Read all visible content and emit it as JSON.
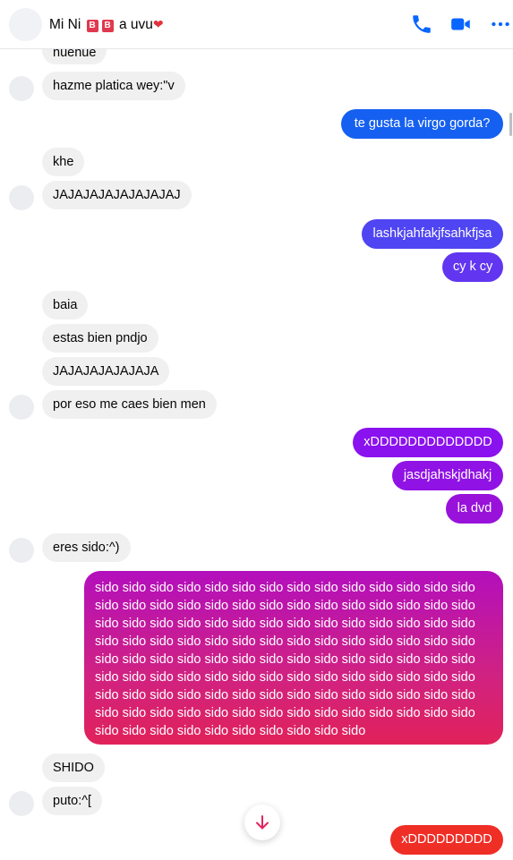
{
  "header": {
    "name_part1": "Mi Ni",
    "badge1": "B",
    "badge2": "B",
    "name_part2": "a uvu",
    "heart": "❤",
    "icons": [
      "phone-icon",
      "video-icon",
      "more-icon"
    ],
    "accent_color": "#0866ff"
  },
  "messages": [
    {
      "dir": "in",
      "text": "huehue"
    },
    {
      "dir": "in",
      "text": "hazme platica wey:\"v"
    },
    {
      "dir": "out",
      "text": "te gusta la virgo gorda?"
    },
    {
      "dir": "in",
      "text": "khe"
    },
    {
      "dir": "in",
      "text": "JAJAJAJAJAJAJAJAJ"
    },
    {
      "dir": "out",
      "text": "lashkjahfakjfsahkfjsa"
    },
    {
      "dir": "out",
      "text": "cy k cy"
    },
    {
      "dir": "in",
      "text": "baia"
    },
    {
      "dir": "in",
      "text": "estas bien pndjo"
    },
    {
      "dir": "in",
      "text": "JAJAJAJAJAJAJA"
    },
    {
      "dir": "in",
      "text": "por eso me caes bien men"
    },
    {
      "dir": "out",
      "text": "xDDDDDDDDDDDDD"
    },
    {
      "dir": "out",
      "text": "jasdjahskjdhakj"
    },
    {
      "dir": "out",
      "text": "la dvd"
    },
    {
      "dir": "in",
      "text": "eres sido:^)"
    },
    {
      "dir": "out",
      "text": "sido sido sido sido sido sido sido sido sido sido sido sido sido sido sido sido sido sido sido sido sido sido sido sido sido sido sido sido sido sido sido sido sido sido sido sido sido sido sido sido sido sido sido sido sido sido sido sido sido sido sido sido sido sido sido sido sido sido sido sido sido sido sido sido sido sido sido sido sido sido sido sido sido sido sido sido sido sido sido sido sido sido sido sido sido sido sido sido sido sido sido sido sido sido sido sido sido sido sido sido sido sido sido sido sido sido sido sido sido sido sido sido sido sido sido sido sido sido sido sido sido sido"
    },
    {
      "dir": "in",
      "text": "SHIDO"
    },
    {
      "dir": "in",
      "text": "puto:^["
    },
    {
      "dir": "out",
      "text": "xDDDDDDDDD"
    }
  ],
  "bubble_colors": {
    "incoming": "#f0f0f0",
    "blue": "#1560f0",
    "indigo": "#5b3ff1",
    "violet": "#8a12ee",
    "magenta_gradient": [
      "#b30fbd",
      "#e1225a"
    ],
    "red": "#ef2e26"
  },
  "scroll_button_icon": "arrow-down-icon"
}
